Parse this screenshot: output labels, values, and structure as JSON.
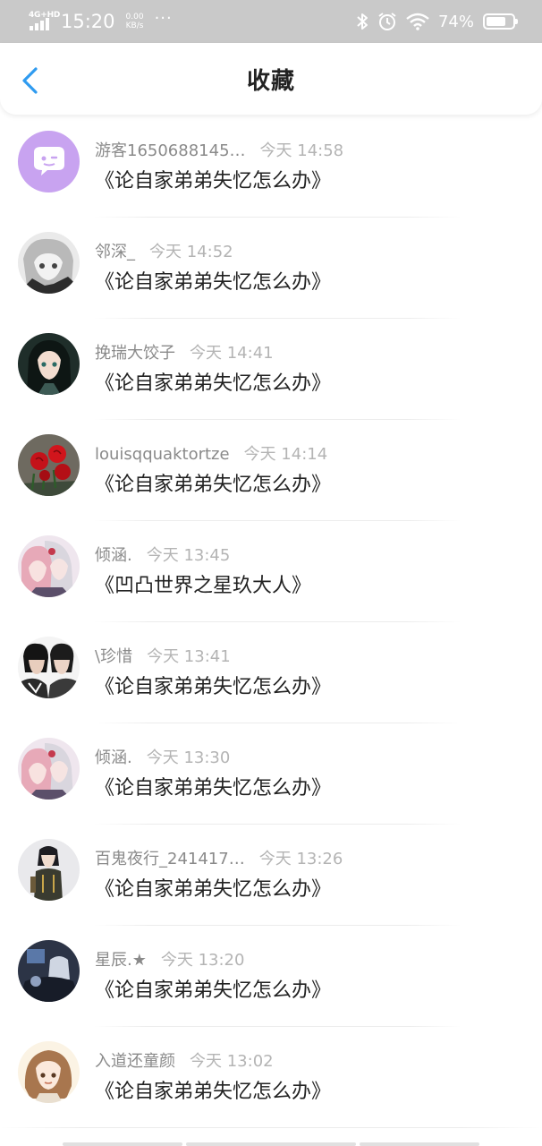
{
  "status_bar": {
    "network": "4G+HD",
    "time": "15:20",
    "net_speed_value": "0.00",
    "net_speed_unit": "KB/s",
    "more": "···",
    "battery_percent": "74%",
    "battery_level": 0.74,
    "icons": [
      "signal-icon",
      "bluetooth-icon",
      "alarm-icon",
      "wifi-icon",
      "battery-icon"
    ]
  },
  "header": {
    "title": "收藏",
    "back_icon": "chevron-left-icon",
    "accent_color": "#2f9bf0"
  },
  "favorites": [
    {
      "user": "游客1650688145…",
      "date": "今天 14:58",
      "work": "《论自家弟弟失忆怎么办》",
      "avatar": "bubble-face"
    },
    {
      "user": "邻深_",
      "date": "今天 14:52",
      "work": "《论自家弟弟失忆怎么办》",
      "avatar": "anime-gray"
    },
    {
      "user": "挽瑞大饺子",
      "date": "今天 14:41",
      "work": "《论自家弟弟失忆怎么办》",
      "avatar": "anime-dark-hair"
    },
    {
      "user": "louisqquaktortze",
      "date": "今天 14:14",
      "work": "《论自家弟弟失忆怎么办》",
      "avatar": "red-roses"
    },
    {
      "user": "倾涵.",
      "date": "今天 13:45",
      "work": "《凹凸世界之星玖大人》",
      "avatar": "anime-pink-silver"
    },
    {
      "user": "\\珍惜",
      "date": "今天 13:41",
      "work": "《论自家弟弟失忆怎么办》",
      "avatar": "two-people"
    },
    {
      "user": "倾涵.",
      "date": "今天 13:30",
      "work": "《论自家弟弟失忆怎么办》",
      "avatar": "anime-pink-silver"
    },
    {
      "user": "百鬼夜行_241417…",
      "date": "今天 13:26",
      "work": "《论自家弟弟失忆怎么办》",
      "avatar": "anime-standing"
    },
    {
      "user": "星辰.★",
      "date": "今天 13:20",
      "work": "《论自家弟弟失忆怎么办》",
      "avatar": "dark-scene"
    },
    {
      "user": "入道还童颜",
      "date": "今天 13:02",
      "work": "《论自家弟弟失忆怎么办》",
      "avatar": "anime-brown-hair"
    }
  ]
}
